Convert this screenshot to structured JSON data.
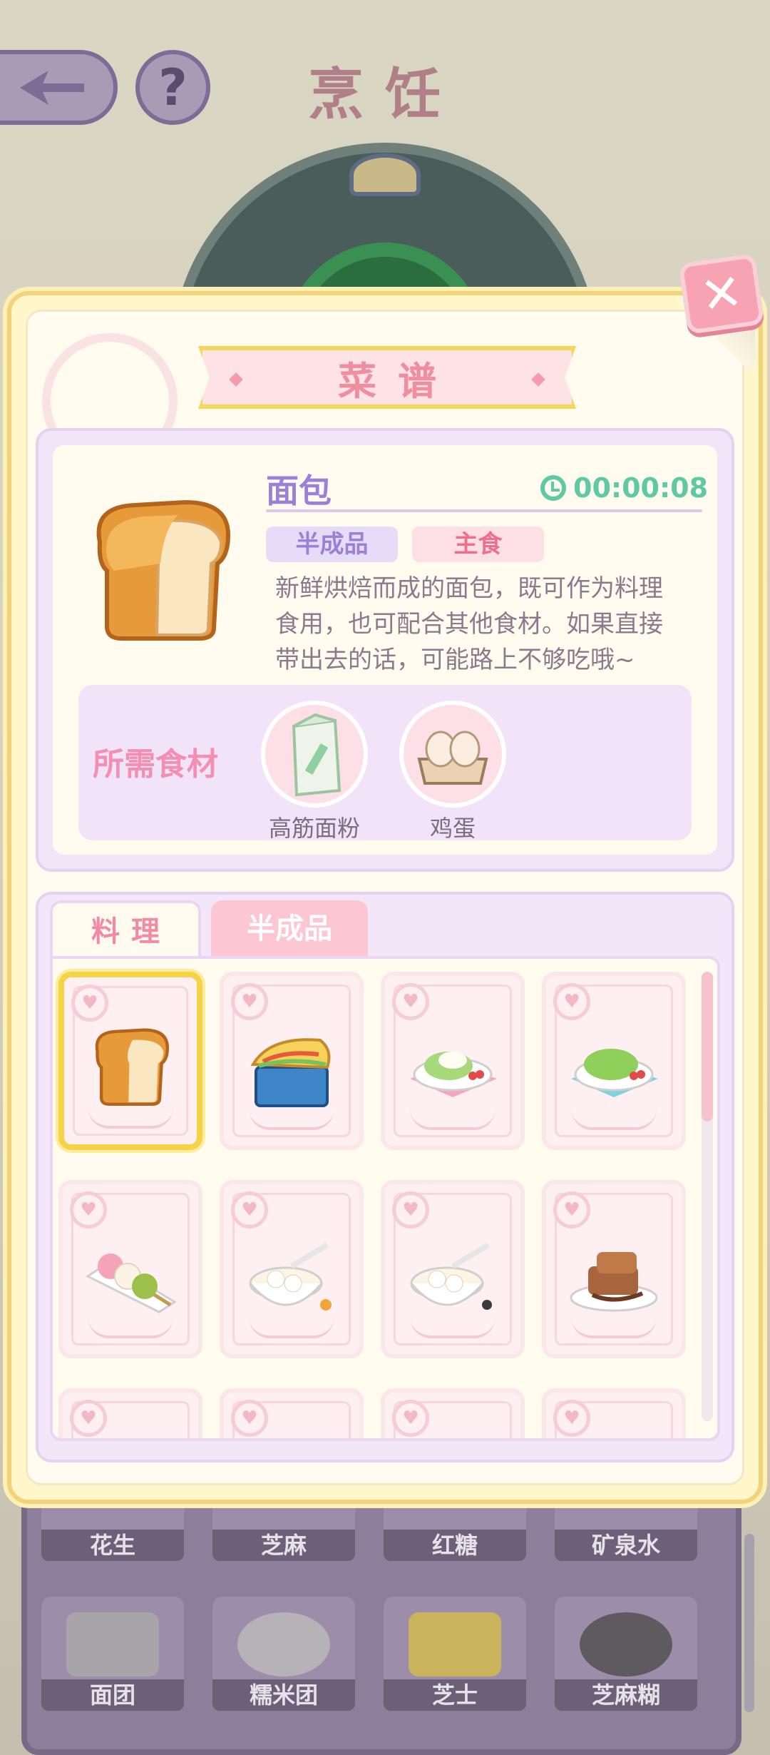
{
  "background": {
    "title": "烹饪",
    "inventory": [
      {
        "label": "花生"
      },
      {
        "label": "芝麻"
      },
      {
        "label": "红糖"
      },
      {
        "label": "矿泉水"
      },
      {
        "label": "面团"
      },
      {
        "label": "糯米团"
      },
      {
        "label": "芝士"
      },
      {
        "label": "芝麻糊"
      }
    ]
  },
  "modal": {
    "title": "菜谱",
    "close_label": "✕",
    "detail": {
      "name": "面包",
      "timer": "00:00:08",
      "tags": [
        "半成品",
        "主食"
      ],
      "description": [
        "新鲜烘焙而成的面包，既可作为料理",
        "食用，也可配合其他食材。如果直接",
        "带出去的话，可能路上不够吃哦~"
      ],
      "ingredients_label": "所需食材",
      "ingredients": [
        {
          "name": "高筋面粉",
          "icon": "flour-bag-icon"
        },
        {
          "name": "鸡蛋",
          "icon": "egg-carton-icon"
        }
      ]
    },
    "tabs": [
      {
        "label": "料理",
        "active": true
      },
      {
        "label": "半成品",
        "active": false
      }
    ],
    "recipes": [
      {
        "name": "bread",
        "selected": true
      },
      {
        "name": "sandwich-box"
      },
      {
        "name": "salad-pink-plate"
      },
      {
        "name": "salad-blue-plate"
      },
      {
        "name": "dango-skewer"
      },
      {
        "name": "sweet-soup-bowl"
      },
      {
        "name": "sesame-soup-bowl"
      },
      {
        "name": "chocolate-waffle"
      }
    ]
  },
  "colors": {
    "accent_pink": "#f08aa5",
    "accent_purple": "#9a80d6",
    "timer_green": "#5fc9a3",
    "frame_gold": "#f5d347"
  }
}
